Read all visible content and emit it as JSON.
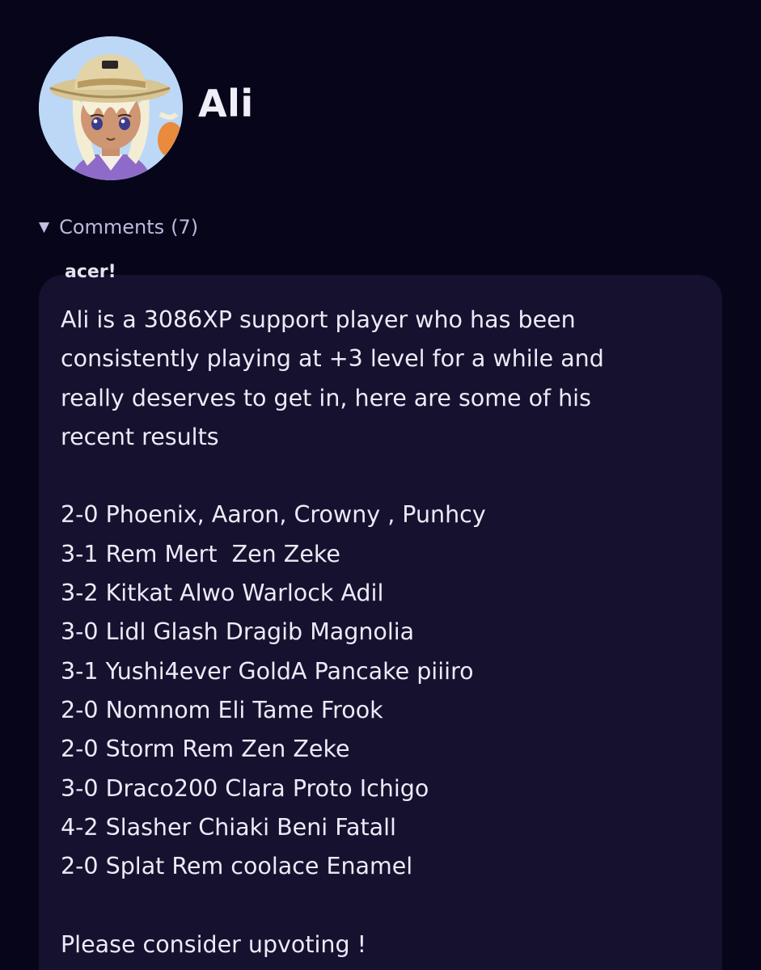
{
  "profile": {
    "name": "Ali",
    "avatar_icon": "anime-character-straw-hat-avatar"
  },
  "comments_section": {
    "toggle_icon": "triangle-down-icon",
    "label": "Comments",
    "count": "(7)"
  },
  "comment": {
    "author": "acer!",
    "lines": [
      "Ali is a 3086XP support player who has been",
      "consistently playing at +3 level for a while and",
      "really deserves to get in, here are some of his",
      "recent results",
      "",
      "2-0 Phoenix, Aaron, Crowny , Punhcy",
      "3-1 Rem Mert  Zen Zeke",
      "3-2 Kitkat Alwo Warlock Adil",
      "3-0 Lidl Glash Dragib Magnolia",
      "3-1 Yushi4ever GoldA Pancake piiiro",
      "2-0 Nomnom Eli Tame Frook",
      "2-0 Storm Rem Zen Zeke",
      "3-0 Draco200 Clara Proto Ichigo",
      "4-2 Slasher Chiaki Beni Fatall",
      "2-0 Splat Rem coolace Enamel",
      "",
      "Please consider upvoting !"
    ]
  },
  "colors": {
    "background": "#070519",
    "card": "#15112f",
    "text": "#eceaf6",
    "muted": "#bdb9dd"
  }
}
